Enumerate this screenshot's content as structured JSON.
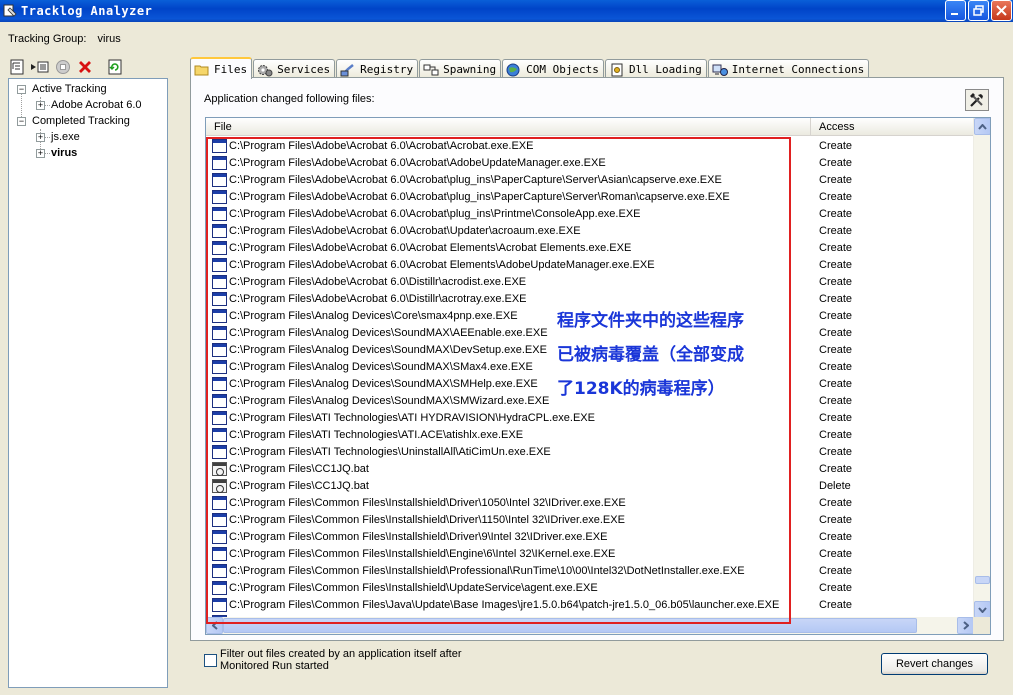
{
  "window": {
    "title": "Tracklog Analyzer"
  },
  "tracking_group": {
    "label": "Tracking Group:",
    "value": "virus"
  },
  "tree": {
    "active_label": "Active Tracking",
    "active_children": [
      "Adobe Acrobat 6.0"
    ],
    "completed_label": "Completed Tracking",
    "completed_children": [
      "js.exe",
      "virus"
    ]
  },
  "tabs": [
    {
      "label": "Files",
      "icon": "folder-icon"
    },
    {
      "label": "Services",
      "icon": "gears-icon"
    },
    {
      "label": "Registry",
      "icon": "registry-icon"
    },
    {
      "label": "Spawning",
      "icon": "spawning-icon"
    },
    {
      "label": "COM Objects",
      "icon": "com-icon"
    },
    {
      "label": "Dll Loading",
      "icon": "dll-icon"
    },
    {
      "label": "Internet Connections",
      "icon": "network-icon"
    }
  ],
  "panel": {
    "heading": "Application changed following files:"
  },
  "list": {
    "columns": [
      "File",
      "Access"
    ],
    "rows": [
      {
        "file": "C:\\Program Files\\Adobe\\Acrobat 6.0\\Acrobat\\Acrobat.exe.EXE",
        "access": "Create",
        "icon": "exe"
      },
      {
        "file": "C:\\Program Files\\Adobe\\Acrobat 6.0\\Acrobat\\AdobeUpdateManager.exe.EXE",
        "access": "Create",
        "icon": "exe"
      },
      {
        "file": "C:\\Program Files\\Adobe\\Acrobat 6.0\\Acrobat\\plug_ins\\PaperCapture\\Server\\Asian\\capserve.exe.EXE",
        "access": "Create",
        "icon": "exe"
      },
      {
        "file": "C:\\Program Files\\Adobe\\Acrobat 6.0\\Acrobat\\plug_ins\\PaperCapture\\Server\\Roman\\capserve.exe.EXE",
        "access": "Create",
        "icon": "exe"
      },
      {
        "file": "C:\\Program Files\\Adobe\\Acrobat 6.0\\Acrobat\\plug_ins\\Printme\\ConsoleApp.exe.EXE",
        "access": "Create",
        "icon": "exe"
      },
      {
        "file": "C:\\Program Files\\Adobe\\Acrobat 6.0\\Acrobat\\Updater\\acroaum.exe.EXE",
        "access": "Create",
        "icon": "exe"
      },
      {
        "file": "C:\\Program Files\\Adobe\\Acrobat 6.0\\Acrobat Elements\\Acrobat Elements.exe.EXE",
        "access": "Create",
        "icon": "exe"
      },
      {
        "file": "C:\\Program Files\\Adobe\\Acrobat 6.0\\Acrobat Elements\\AdobeUpdateManager.exe.EXE",
        "access": "Create",
        "icon": "exe"
      },
      {
        "file": "C:\\Program Files\\Adobe\\Acrobat 6.0\\Distillr\\acrodist.exe.EXE",
        "access": "Create",
        "icon": "exe"
      },
      {
        "file": "C:\\Program Files\\Adobe\\Acrobat 6.0\\Distillr\\acrotray.exe.EXE",
        "access": "Create",
        "icon": "exe"
      },
      {
        "file": "C:\\Program Files\\Analog Devices\\Core\\smax4pnp.exe.EXE",
        "access": "Create",
        "icon": "exe"
      },
      {
        "file": "C:\\Program Files\\Analog Devices\\SoundMAX\\AEEnable.exe.EXE",
        "access": "Create",
        "icon": "exe"
      },
      {
        "file": "C:\\Program Files\\Analog Devices\\SoundMAX\\DevSetup.exe.EXE",
        "access": "Create",
        "icon": "exe"
      },
      {
        "file": "C:\\Program Files\\Analog Devices\\SoundMAX\\SMax4.exe.EXE",
        "access": "Create",
        "icon": "exe"
      },
      {
        "file": "C:\\Program Files\\Analog Devices\\SoundMAX\\SMHelp.exe.EXE",
        "access": "Create",
        "icon": "exe"
      },
      {
        "file": "C:\\Program Files\\Analog Devices\\SoundMAX\\SMWizard.exe.EXE",
        "access": "Create",
        "icon": "exe"
      },
      {
        "file": "C:\\Program Files\\ATI Technologies\\ATI HYDRAVISION\\HydraCPL.exe.EXE",
        "access": "Create",
        "icon": "exe"
      },
      {
        "file": "C:\\Program Files\\ATI Technologies\\ATI.ACE\\atishlx.exe.EXE",
        "access": "Create",
        "icon": "exe"
      },
      {
        "file": "C:\\Program Files\\ATI Technologies\\UninstallAll\\AtiCimUn.exe.EXE",
        "access": "Create",
        "icon": "exe"
      },
      {
        "file": "C:\\Program Files\\CC1JQ.bat",
        "access": "Create",
        "icon": "bat"
      },
      {
        "file": "C:\\Program Files\\CC1JQ.bat",
        "access": "Delete",
        "icon": "bat"
      },
      {
        "file": "C:\\Program Files\\Common Files\\Installshield\\Driver\\1050\\Intel 32\\IDriver.exe.EXE",
        "access": "Create",
        "icon": "exe"
      },
      {
        "file": "C:\\Program Files\\Common Files\\Installshield\\Driver\\1150\\Intel 32\\IDriver.exe.EXE",
        "access": "Create",
        "icon": "exe"
      },
      {
        "file": "C:\\Program Files\\Common Files\\Installshield\\Driver\\9\\Intel 32\\IDriver.exe.EXE",
        "access": "Create",
        "icon": "exe"
      },
      {
        "file": "C:\\Program Files\\Common Files\\Installshield\\Engine\\6\\Intel 32\\IKernel.exe.EXE",
        "access": "Create",
        "icon": "exe"
      },
      {
        "file": "C:\\Program Files\\Common Files\\Installshield\\Professional\\RunTime\\10\\00\\Intel32\\DotNetInstaller.exe.EXE",
        "access": "Create",
        "icon": "exe"
      },
      {
        "file": "C:\\Program Files\\Common Files\\Installshield\\UpdateService\\agent.exe.EXE",
        "access": "Create",
        "icon": "exe"
      },
      {
        "file": "C:\\Program Files\\Common Files\\Java\\Update\\Base Images\\jre1.5.0.b64\\patch-jre1.5.0_06.b05\\launcher.exe.EXE",
        "access": "Create",
        "icon": "exe"
      },
      {
        "file": "C:\\Program Files\\Common Files\\Lenovo\\PMCP\\bmgr.exe.EXE",
        "access": "Create",
        "icon": "exe"
      }
    ]
  },
  "annotation": {
    "lines": [
      "程序文件夹中的这些程序",
      "已被病毒覆盖（全部变成",
      "了128K的病毒程序）"
    ],
    "text_color": "#1a36d8",
    "box_color": "#e02020"
  },
  "filter": {
    "label_line1": "Filter out files created by an application itself after",
    "label_line2": "Monitored Run started",
    "checked": false
  },
  "revert_button": {
    "label": "Revert changes"
  }
}
